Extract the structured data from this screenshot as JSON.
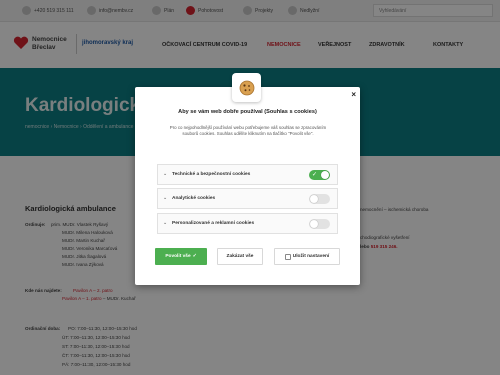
{
  "topbar": {
    "phone": "+420 519 315 111",
    "email": "info@nembv.cz",
    "plan": "Plán",
    "pohotovost": "Pohotovost",
    "projekty": "Projekty",
    "nedlyzni": "Nedlyžní",
    "search_placeholder": "Vyhledávání"
  },
  "header": {
    "logo_line1": "Nemocnice",
    "logo_line2": "Břeclav",
    "logo_kraj": "jihomoravský kraj",
    "nav": [
      "OČKOVACÍ CENTRUM COVID-19",
      "NEMOCNICE",
      "VEŘEJNOST",
      "ZDRAVOTNÍK",
      "KONTAKTY"
    ]
  },
  "hero": {
    "title": "Kardiologická ambulance",
    "breadcrumbs": "nemocnice › Nemocnice › Oddělení a ambulance"
  },
  "content": {
    "heading": "Kardiologická ambulance",
    "ordinuje_label": "Ordinuje:",
    "ordinuje_doctors": [
      "prim. MUDr. Vlastek Ryšavý",
      "MUDr. Milena Halouková",
      "MUDr. Martin Kuchař",
      "MUDr. Veronika Marcaťová",
      "MUDr. Jitka Šagalová",
      "MUDr. Ivana Zýková"
    ],
    "kde_label": "Kde nás najdete:",
    "kde_line1": "Pavilon A – 2. patro",
    "kde_line2": "Pavilon A – 1. patro",
    "kde_line2_suffix": " – MUDr. Kuchař",
    "ordinacni_label": "Ordinační doba:",
    "hours": [
      "PO: 7:00–11:30, 12:00–15:30 hod",
      "ÚT: 7:00–11:30, 12:00–15:30 hod",
      "ST: 7:00–11:30, 12:00–15:30 hod",
      "ČT: 7:00–11:30, 12:00–15:30 hod",
      "PÁ: 7:00–11:30, 12:00–15:30 hod"
    ],
    "right_line1": "nemocnění – ischemická choroba",
    "right_line2": "chodiografické vyšetření",
    "right_line3_prefix": "lebo ",
    "right_line3_phone": "519 315 246."
  },
  "modal": {
    "title": "Aby se vám web dobře používal (Souhlas s cookies)",
    "description": "Pro co nejpohodlnější používání webu potřebujeme váš souhlas se zpracováním souborů cookies. Souhlas udělíte kliknutím na tlačítko \"Povolit vše\".",
    "categories": [
      {
        "label": "Technické a bezpečnostní cookies",
        "enabled": true
      },
      {
        "label": "Analytické cookies",
        "enabled": false
      },
      {
        "label": "Personalizované a reklamní cookies",
        "enabled": false
      }
    ],
    "accept_label": "Povolit vše",
    "reject_label": "Zakázat vše",
    "save_label": "Uložit nastavení",
    "close_label": "×"
  },
  "colors": {
    "accent_red": "#d5232f",
    "teal": "#0d7f84",
    "green": "#4caf50"
  }
}
